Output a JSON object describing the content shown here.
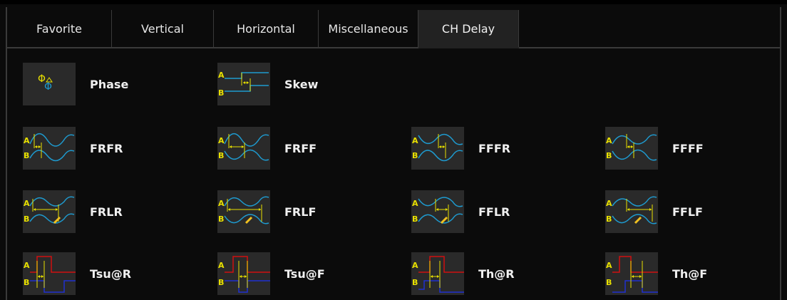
{
  "tabs": [
    {
      "label": "Favorite",
      "active": false
    },
    {
      "label": "Vertical",
      "active": false
    },
    {
      "label": "Horizontal",
      "active": false
    },
    {
      "label": "Miscellaneous",
      "active": false
    },
    {
      "label": "CH Delay",
      "active": true
    }
  ],
  "items": [
    {
      "label": "Phase",
      "icon": "phase-icon"
    },
    {
      "label": "Skew",
      "icon": "skew-icon"
    },
    {
      "label": "FRFR",
      "icon": "frfr-icon"
    },
    {
      "label": "FRFF",
      "icon": "frff-icon"
    },
    {
      "label": "FFFR",
      "icon": "fffr-icon"
    },
    {
      "label": "FFFF",
      "icon": "ffff-icon"
    },
    {
      "label": "FRLR",
      "icon": "frlr-icon"
    },
    {
      "label": "FRLF",
      "icon": "frlf-icon"
    },
    {
      "label": "FFLR",
      "icon": "fflr-icon"
    },
    {
      "label": "FFLF",
      "icon": "fflf-icon"
    },
    {
      "label": "Tsu@R",
      "icon": "tsu-rise-icon"
    },
    {
      "label": "Tsu@F",
      "icon": "tsu-fall-icon"
    },
    {
      "label": "Th@R",
      "icon": "th-rise-icon"
    },
    {
      "label": "Th@F",
      "icon": "th-fall-icon"
    }
  ],
  "icon_text": {
    "a": "A",
    "b": "B"
  },
  "colors": {
    "ch_a": "#e8e000",
    "ch_b": "#1e9bd0",
    "tsu_a": "#d01010",
    "tsu_b": "#2030d0",
    "marker": "#f0c020"
  }
}
